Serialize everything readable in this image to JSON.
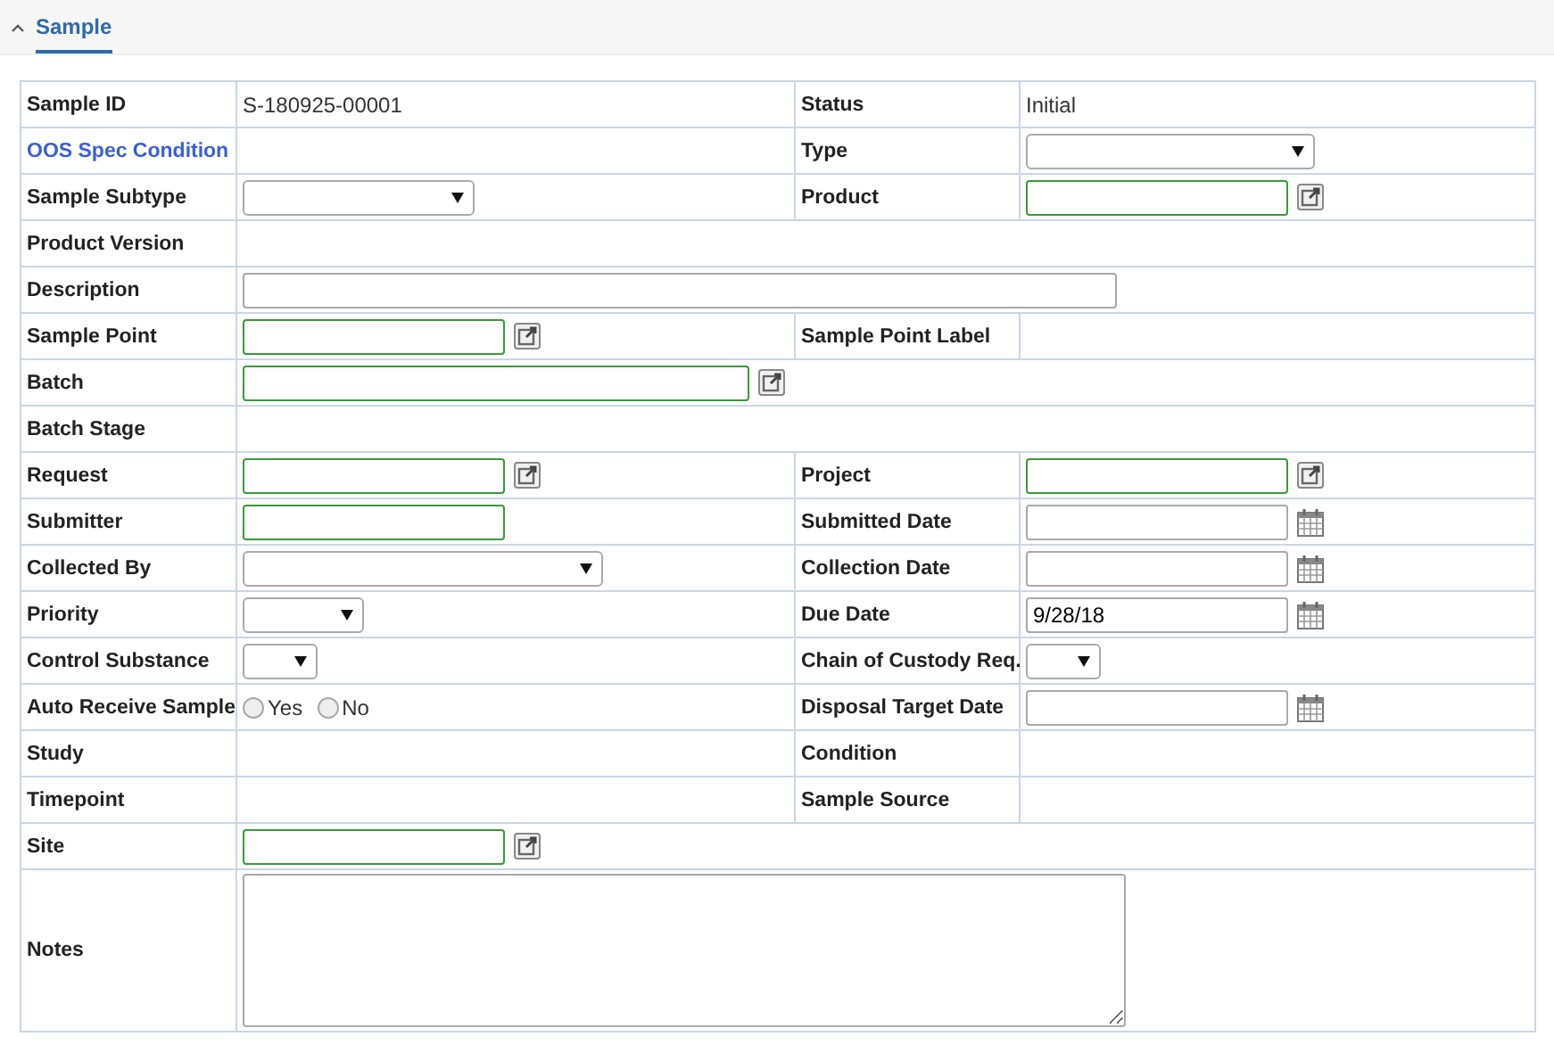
{
  "section_tab": {
    "label": "Sample",
    "expanded": true,
    "selected": true
  },
  "rows": [
    {
      "pairs": [
        {
          "label": "Sample ID",
          "field": {
            "kind": "text",
            "value": "S-180925-00001"
          }
        },
        {
          "label": "Status",
          "field": {
            "kind": "text",
            "value": "Initial"
          }
        }
      ]
    },
    {
      "pairs": [
        {
          "label": "OOS Spec Condition",
          "link": true
        },
        {
          "label": "Type",
          "field": {
            "kind": "select"
          }
        }
      ]
    },
    {
      "pairs": [
        {
          "label": "Sample Subtype",
          "field": {
            "kind": "select"
          }
        },
        {
          "label": "Product",
          "field": {
            "kind": "lookup",
            "required": true
          }
        }
      ]
    },
    {
      "pairs": [
        {
          "label": "Product Version"
        }
      ]
    },
    {
      "pairs": [
        {
          "label": "Description",
          "field": {
            "kind": "input",
            "required": false
          }
        }
      ]
    },
    {
      "pairs": [
        {
          "label": "Sample Point",
          "field": {
            "kind": "lookup",
            "required": true
          }
        },
        {
          "label": "Sample Point Label"
        }
      ]
    },
    {
      "pairs": [
        {
          "label": "Batch",
          "field": {
            "kind": "lookup",
            "required": true
          }
        }
      ]
    },
    {
      "pairs": [
        {
          "label": "Batch Stage"
        }
      ]
    },
    {
      "pairs": [
        {
          "label": "Request",
          "field": {
            "kind": "lookup",
            "required": true
          }
        },
        {
          "label": "Project",
          "field": {
            "kind": "lookup",
            "required": true
          }
        }
      ]
    },
    {
      "pairs": [
        {
          "label": "Submitter",
          "field": {
            "kind": "input",
            "required": true
          }
        },
        {
          "label": "Submitted Date",
          "field": {
            "kind": "date"
          }
        }
      ]
    },
    {
      "pairs": [
        {
          "label": "Collected By",
          "field": {
            "kind": "select"
          }
        },
        {
          "label": "Collection Date",
          "field": {
            "kind": "date"
          }
        }
      ]
    },
    {
      "pairs": [
        {
          "label": "Priority",
          "field": {
            "kind": "select"
          }
        },
        {
          "label": "Due Date",
          "field": {
            "kind": "date",
            "value": "9/28/18"
          }
        }
      ]
    },
    {
      "pairs": [
        {
          "label": "Control Substance",
          "field": {
            "kind": "select"
          }
        },
        {
          "label": "Chain of Custody Req.",
          "field": {
            "kind": "select"
          }
        }
      ]
    },
    {
      "pairs": [
        {
          "label": "Auto Receive Sample",
          "field": {
            "kind": "radio",
            "options": [
              {
                "label": "Yes",
                "selected": false
              },
              {
                "label": "No",
                "selected": false
              }
            ]
          }
        },
        {
          "label": "Disposal Target Date",
          "field": {
            "kind": "date"
          }
        }
      ]
    },
    {
      "pairs": [
        {
          "label": "Study"
        },
        {
          "label": "Condition"
        }
      ]
    },
    {
      "pairs": [
        {
          "label": "Timepoint"
        },
        {
          "label": "Sample Source"
        }
      ]
    },
    {
      "pairs": [
        {
          "label": "Site",
          "field": {
            "kind": "lookup",
            "required": true
          }
        }
      ]
    },
    {
      "pairs": [
        {
          "label": "Notes",
          "field": {
            "kind": "textarea"
          }
        }
      ]
    }
  ]
}
